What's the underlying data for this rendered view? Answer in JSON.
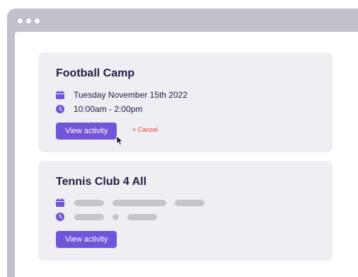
{
  "colors": {
    "window_frame": "#c3c0cb",
    "card_bg": "#efeef2",
    "accent": "#7055d8",
    "title_text": "#232044",
    "cancel": "#e2453c",
    "skeleton": "#c7c5cc"
  },
  "window": {
    "controls": [
      "window-dot",
      "window-dot",
      "window-dot"
    ]
  },
  "activities": [
    {
      "title": "Football Camp",
      "date": "Tuesday November 15th 2022",
      "time": "10:00am - 2:00pm",
      "button_label": "View activity",
      "cancel_label": "× Cancel",
      "icons": [
        "calendar-icon",
        "clock-icon"
      ]
    },
    {
      "title": "Tennis Club 4 All",
      "date": "",
      "time": "",
      "button_label": "View activity",
      "icons": [
        "calendar-icon",
        "clock-icon"
      ],
      "loading": true
    }
  ],
  "cursor_icon": "pointer-cursor-icon"
}
